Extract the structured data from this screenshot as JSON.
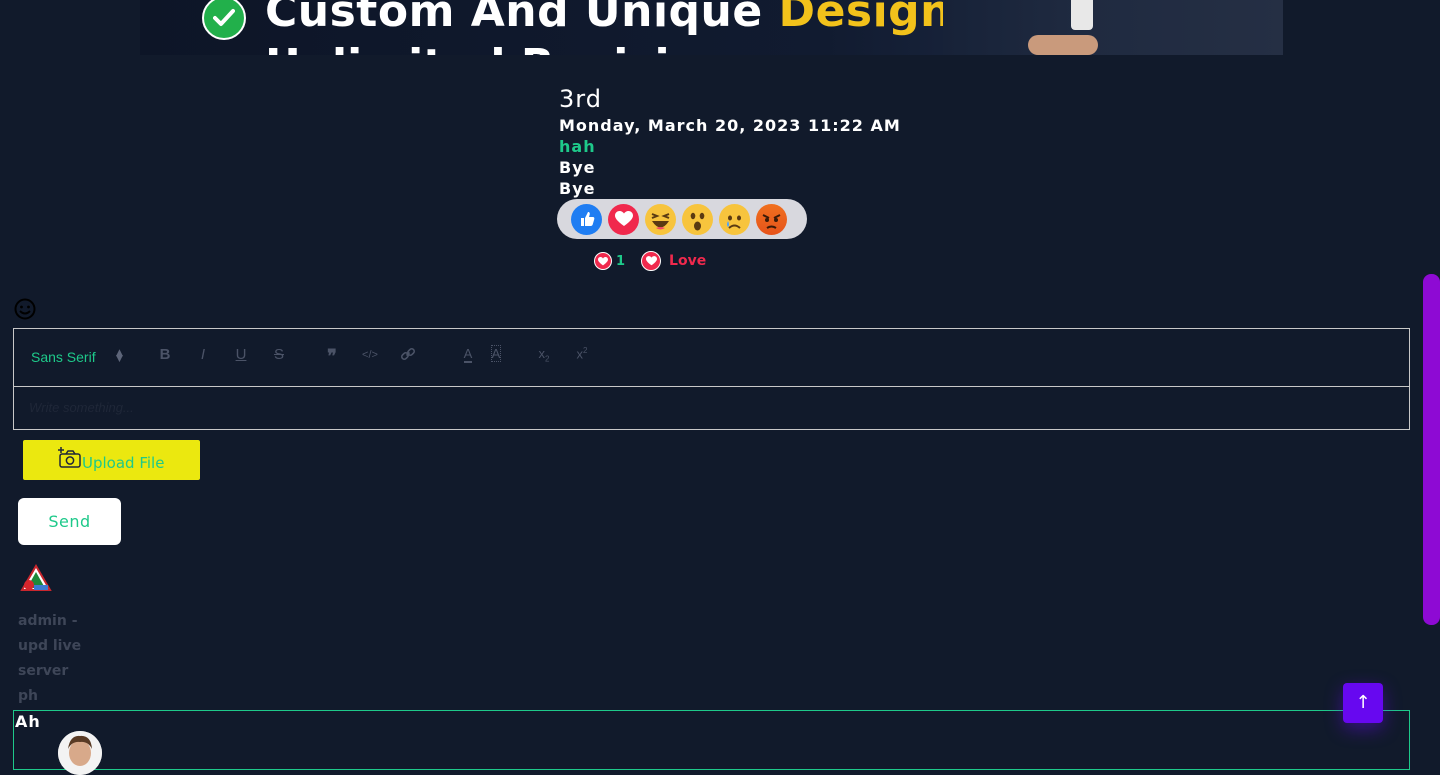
{
  "banner": {
    "headline_prefix": "Custom And Unique ",
    "headline_highlight": "Design.",
    "headline_second_line_partial": "Unlimited Revisions"
  },
  "post": {
    "title": "3rd",
    "date": "Monday, March 20, 2023 11:22 AM",
    "lines": [
      "hah",
      "Bye",
      "Bye"
    ]
  },
  "reactions": {
    "options": [
      "like-icon",
      "love-icon",
      "haha-icon",
      "wow-icon",
      "sad-icon",
      "angry-icon"
    ],
    "summary_count": "1",
    "current_reaction_label": "Love"
  },
  "editor": {
    "font_select": "Sans Serif",
    "toolbar_buttons": [
      "bold",
      "italic",
      "underline",
      "strike",
      "blockquote",
      "code",
      "link",
      "text-color",
      "background-color",
      "subscript",
      "superscript"
    ],
    "placeholder": "Write something..."
  },
  "upload_label": "Upload File",
  "send_label": "Send",
  "comment": {
    "author_lines": [
      "admin -",
      "upd live",
      "server",
      "ph"
    ],
    "text": "Ah"
  },
  "colors": {
    "accent": "#1ec98a",
    "love": "#f0294d",
    "upload_bg": "#ebe80f",
    "scrollbar": "#8e0ad4",
    "to_top": "#6708f0",
    "background": "#111a2b"
  }
}
